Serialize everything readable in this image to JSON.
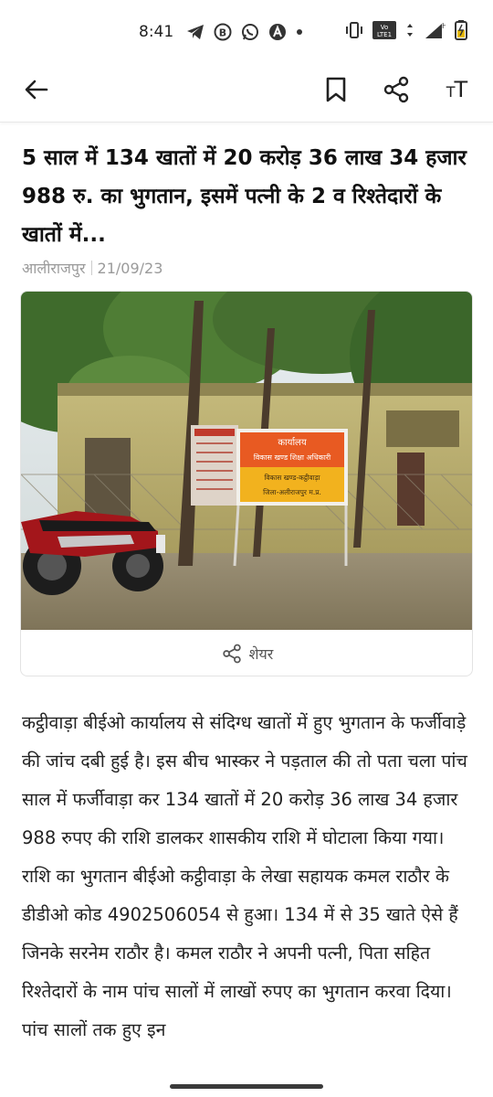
{
  "status_bar": {
    "time": "8:41",
    "left_icons": [
      "telegram-icon",
      "b-app-icon",
      "whatsapp-icon",
      "a-app-icon",
      "dot-icon"
    ],
    "right_icons": [
      "vibrate-icon",
      "volte-icon",
      "wifi-icon",
      "signal-icon",
      "battery-icon"
    ],
    "volte_label": "Vo LTE1",
    "network_label": "H"
  },
  "toolbar": {
    "back_icon": "arrow-left-icon",
    "bookmark_icon": "bookmark-icon",
    "share_icon": "share-icon",
    "text_size_label_small": "T",
    "text_size_label_large": "T"
  },
  "article": {
    "headline": "5 साल में 134 खातों में 20 करोड़ 36 लाख 34 हजार 988 रु. का भुगतान, इसमें पत्नी के 2 व रिश्तेदारों के खातों में...",
    "location": "आलीराजपुर",
    "date": "21/09/23",
    "photo": {
      "sign_line1": "कार्यालय",
      "sign_line2": "विकास खण्ड शिक्षा अधिकारी",
      "sign_line3": "विकास खण्ड-कट्ठीवाड़ा",
      "sign_line4": "जिला-अलीराजपुर म.प्र."
    },
    "share_label": "शेयर",
    "body": "कट्ठीवाड़ा बीईओ कार्यालय से संदिग्ध खातों में हुए भुगतान के फर्जीवाड़े की जांच दबी हुई है। इस बीच भास्कर ने पड़ताल की तो पता चला पांच साल में फर्जीवाड़ा कर 134 खातों में 20 करोड़ 36 लाख 34 हजार 988 रुपए की राशि डालकर शासकीय राशि में घोटाला किया गया। राशि का भुगतान बीईओ कट्ठीवाड़ा के लेखा सहायक कमल राठौर के डीडीओ कोड 4902506054 से हुआ। 134 में से 35 खाते ऐसे हैं जिनके सरनेम राठौर है। कमल राठौर ने अपनी पत्नी, पिता सहित रिश्तेदारों के नाम पांच सालों में लाखों रुपए का भुगतान करवा दिया। पांच सालों तक हुए इन"
  },
  "colors": {
    "sign_top": "#e85a22",
    "sign_bottom": "#f2b21e",
    "wall": "#b9ad6e",
    "ground": "#8d8266"
  }
}
